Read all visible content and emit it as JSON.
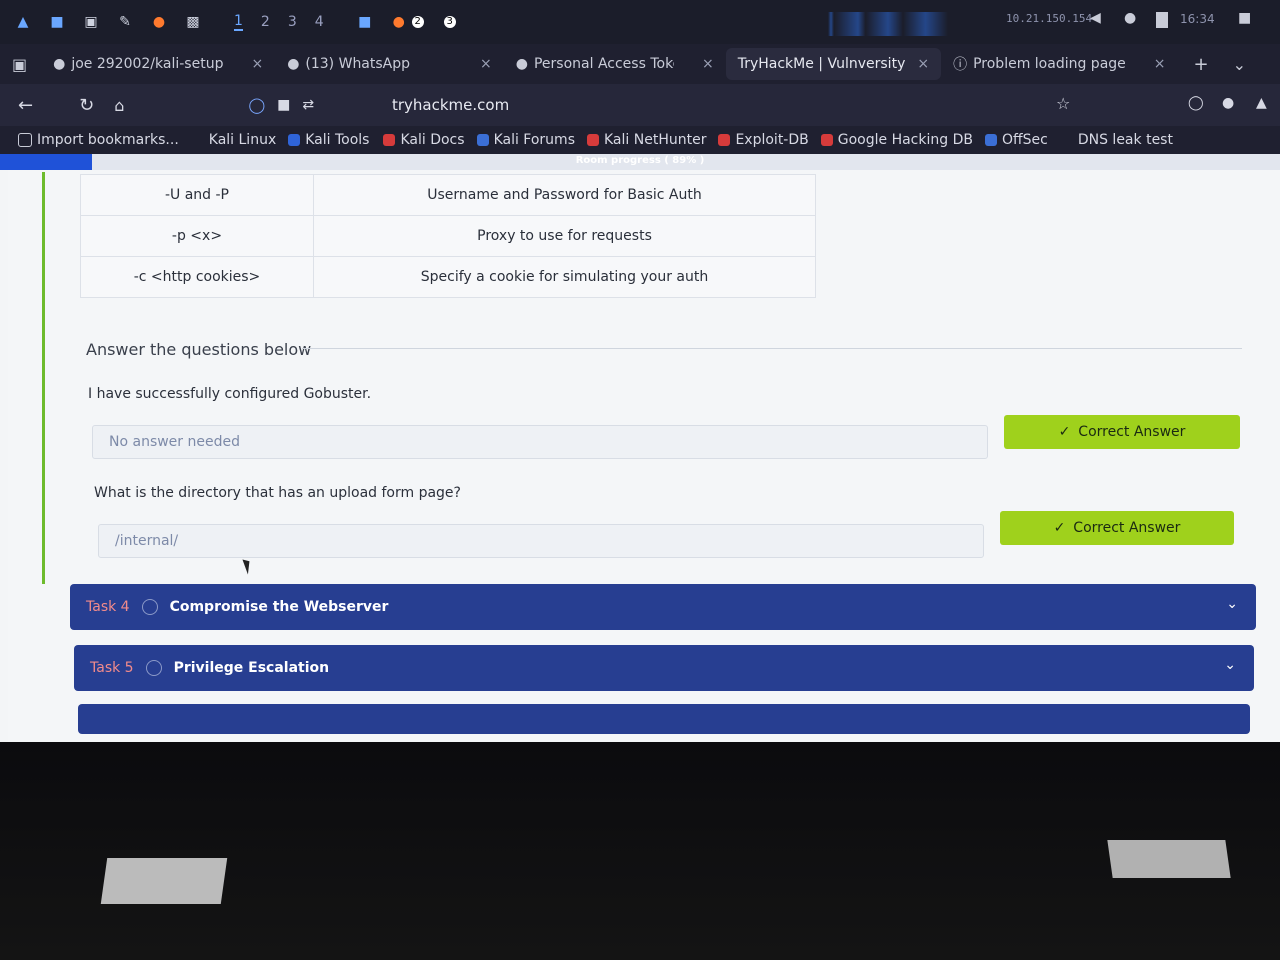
{
  "taskbar": {
    "workspaces": [
      "1",
      "2",
      "3",
      "4"
    ],
    "badges": [
      "2",
      "3"
    ],
    "ip": "10.21.150.154",
    "clock": "16:34"
  },
  "tabs": [
    {
      "label": "joe 292002/kali-setup",
      "icon": "github-icon"
    },
    {
      "label": "(13) WhatsApp",
      "icon": "whatsapp-icon"
    },
    {
      "label": "Personal Access Token",
      "icon": "github-icon"
    },
    {
      "label": "TryHackMe | Vulnversity",
      "icon": "tryhackme-icon"
    },
    {
      "label": "Problem loading page",
      "icon": "info-icon"
    }
  ],
  "url": "tryhackme.com",
  "bookmarks": [
    {
      "label": "Import bookmarks...",
      "color": "#c9ccd8"
    },
    {
      "label": "Kali Linux",
      "color": "#3b6fd6"
    },
    {
      "label": "Kali Tools",
      "color": "#2f64d8"
    },
    {
      "label": "Kali Docs",
      "color": "#d63b3b"
    },
    {
      "label": "Kali Forums",
      "color": "#3b6fd6"
    },
    {
      "label": "Kali NetHunter",
      "color": "#d63b3b"
    },
    {
      "label": "Exploit-DB",
      "color": "#d63b3b"
    },
    {
      "label": "Google Hacking DB",
      "color": "#d63b3b"
    },
    {
      "label": "OffSec",
      "color": "#3b6fd6"
    },
    {
      "label": "DNS leak test",
      "color": "#c9ccd8"
    }
  ],
  "progress": {
    "label": "Room progress ( 89% )",
    "percent": 89
  },
  "options_table": [
    {
      "flag": "-U and -P",
      "desc": "Username and Password for Basic Auth"
    },
    {
      "flag": "-p <x>",
      "desc": "Proxy to use for requests"
    },
    {
      "flag": "-c <http cookies>",
      "desc": "Specify a cookie for simulating your auth"
    }
  ],
  "answer_heading": "Answer the questions below",
  "questions": [
    {
      "text": "I have successfully configured Gobuster.",
      "answer": "No answer needed",
      "button": "Correct Answer"
    },
    {
      "text": "What is the directory that has an upload form page?",
      "answer": "/internal/",
      "button": "Correct Answer"
    }
  ],
  "tasks": [
    {
      "num": "Task 4",
      "title": "Compromise the Webserver"
    },
    {
      "num": "Task 5",
      "title": "Privilege Escalation"
    }
  ]
}
